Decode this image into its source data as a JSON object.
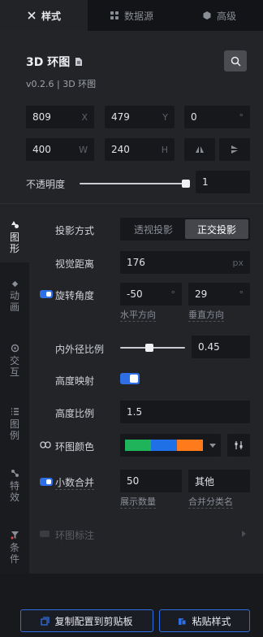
{
  "tabs": [
    {
      "label": "样式",
      "icon": "style-icon"
    },
    {
      "label": "数据源",
      "icon": "datasource-icon"
    },
    {
      "label": "高级",
      "icon": "advanced-icon"
    }
  ],
  "component": {
    "title": "3D 环图",
    "version": "v0.2.6 | 3D 环图"
  },
  "position": {
    "x": "809",
    "x_unit": "X",
    "y": "479",
    "y_unit": "Y",
    "rotation": "0",
    "rotation_unit": "°",
    "width": "400",
    "width_unit": "W",
    "height": "240",
    "height_unit": "H"
  },
  "opacity": {
    "label": "不透明度",
    "value": "1",
    "level": 1
  },
  "sidebar": [
    {
      "label": "图形",
      "icon": "shape-icon",
      "active": true
    },
    {
      "label": "动画",
      "icon": "animation-icon"
    },
    {
      "label": "交互",
      "icon": "interaction-icon"
    },
    {
      "label": "图例",
      "icon": "legend-icon"
    },
    {
      "label": "特效",
      "icon": "effects-icon"
    },
    {
      "label": "条件",
      "icon": "condition-icon"
    }
  ],
  "settings": {
    "projection": {
      "label": "投影方式",
      "options": [
        "透视投影",
        "正交投影"
      ],
      "selected": "正交投影"
    },
    "view_distance": {
      "label": "视觉距离",
      "value": "176",
      "unit": "px"
    },
    "rotation_angle": {
      "label": "旋转角度",
      "horizontal": "-50",
      "vertical": "29",
      "unit": "°",
      "horizontal_label": "水平方向",
      "vertical_label": "垂直方向"
    },
    "radius_ratio": {
      "label": "内外径比例",
      "value": "0.45"
    },
    "height_mapping": {
      "label": "高度映射"
    },
    "height_ratio": {
      "label": "高度比例",
      "value": "1.5"
    },
    "ring_color": {
      "label": "环图颜色",
      "colors": [
        "#1fb35a",
        "#1f6fe6",
        "#ff7a1a"
      ]
    },
    "decimal_merge": {
      "label": "小数合并",
      "count": "50",
      "count_label": "展示数量",
      "other": "其他",
      "other_label": "合并分类名"
    },
    "ring_annotation": {
      "label": "环图标注"
    }
  },
  "buttons": {
    "copy": "复制配置到剪贴板",
    "paste": "粘贴样式"
  }
}
